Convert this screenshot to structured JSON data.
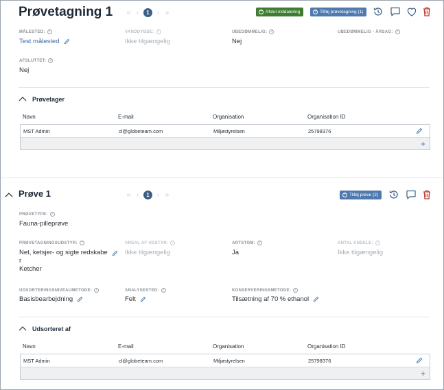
{
  "section1": {
    "title": "Prøvetagning 1",
    "page_number": "1",
    "btn_finish": "Afslut inddatering",
    "btn_add": "Tilføj prøvetagning (1)",
    "fields": {
      "malested_label": "MÅLESTED:",
      "malested_value": "Test målested",
      "vanddybde_label": "VANDDYBDE:",
      "vanddybde_value": "Ikke tilgængelig",
      "ubedommelig_label": "UBEDØMMELIG:",
      "ubedommelig_value": "Nej",
      "arsag_label": "UBEDØMMELIG - ÅRSAG:",
      "afsluttet_label": "AFSLUTTET:",
      "afsluttet_value": "Nej"
    },
    "sub_title": "Prøvetager",
    "table": {
      "headers": [
        "Navn",
        "E-mail",
        "Organisation",
        "Organisation ID"
      ],
      "rows": [
        [
          "MST Admin",
          "cl@globeteam.com",
          "Miljøstyrelsen",
          "25798376"
        ]
      ]
    }
  },
  "section2": {
    "title": "Prøve 1",
    "page_number": "1",
    "btn_add": "Tilføj prøve (2)",
    "fields": {
      "provetype_label": "PRØVETYPE:",
      "provetype_value": "Fauna-pilleprøve",
      "udstyr_label": "PRØVETAGNINGSUDSTYR:",
      "udstyr_value_line1": "Net, ketsjer- og sigte redskabe",
      "udstyr_value_line2": "r",
      "udstyr_value_line3": "Ketcher",
      "areal_label": "AREAL AF UDSTYR:",
      "areal_value": "Ikke tilgængelig",
      "artstom_label": "ARTSTOM:",
      "artstom_value": "Ja",
      "antal_label": "ANTAL ANDELE:",
      "antal_value": "Ikke tilgængelig",
      "udsortering_label": "UDSORTERINGSNIVEAUMETODE:",
      "udsortering_value": "Basisbearbejdning",
      "analysested_label": "ANALYSESTED:",
      "analysested_value": "Felt",
      "konservering_label": "KONSERVERINGSMETODE:",
      "konservering_value": "Tilsætning af 70 % ethanol"
    },
    "sub_title": "Udsorteret af",
    "table": {
      "headers": [
        "Navn",
        "E-mail",
        "Organisation",
        "Organisation ID"
      ],
      "rows": [
        [
          "MST Admin",
          "cl@globeteam.com",
          "Miljøstyrelsen",
          "25798376"
        ]
      ]
    }
  },
  "colors": {
    "accent_blue": "#4f7ab0",
    "finish_green": "#3f7d31",
    "delete_red": "#c0392b",
    "link_blue": "#3b6ea5"
  }
}
